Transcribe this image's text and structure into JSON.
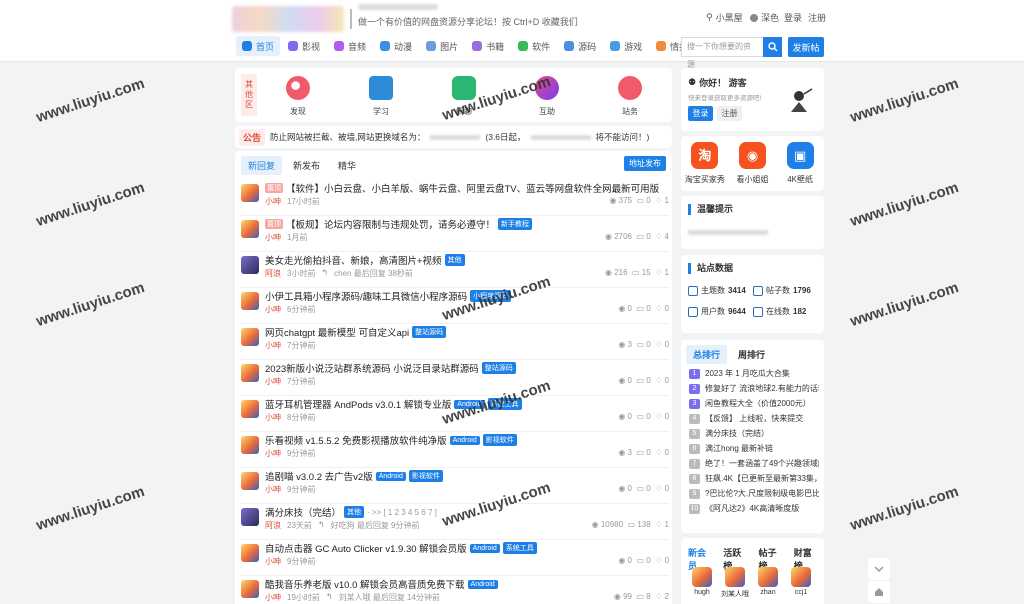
{
  "header": {
    "tagline": "做一个有价值的网盘资源分享论坛！按 Ctrl+D 收藏我们",
    "links": {
      "user": "小黑屋",
      "theme": "深色",
      "login": "登录",
      "register": "注册"
    }
  },
  "menu": [
    {
      "label": "首页",
      "color": "#1e80e6"
    },
    {
      "label": "影视",
      "color": "#7c6cf0"
    },
    {
      "label": "音频",
      "color": "#b45cf0"
    },
    {
      "label": "动漫",
      "color": "#3a8ee6"
    },
    {
      "label": "图片",
      "color": "#6a9ee0"
    },
    {
      "label": "书籍",
      "color": "#9c6ce0"
    },
    {
      "label": "软件",
      "color": "#3cba5a"
    },
    {
      "label": "源码",
      "color": "#4a8fe0"
    },
    {
      "label": "游戏",
      "color": "#4a9be6"
    },
    {
      "label": "情报",
      "color": "#f08a3c"
    }
  ],
  "search": {
    "placeholder": "搜一下你想要的资源",
    "post_label": "发新帖"
  },
  "categories": {
    "side_label": "其他区",
    "items": [
      "发现",
      "学习",
      "闲聊",
      "互助",
      "站务"
    ]
  },
  "notice": {
    "tag": "公告",
    "text": "防止网站被拦截、被墙,网站更换域名为：",
    "text2": "(3.6日起，",
    "text3": "将不能访问！)"
  },
  "thread_tabs": {
    "tabs": [
      "新回复",
      "新发布",
      "精华"
    ],
    "publish_label": "地址发布"
  },
  "threads": [
    {
      "hot": "置顶",
      "title": "【软件】小白云盘、小白羊版、蜗牛云盘、阿里云盘TV、蓝云等网盘软件全网最新可用版",
      "badges": [],
      "author": "小呻",
      "time": "17小时前",
      "last": "",
      "views": "375",
      "replies": "0",
      "likes": "1",
      "purple": false
    },
    {
      "hot": "置顶",
      "title": "【板规】论坛内容限制与违规处罚，请务必遵守！",
      "badges": [
        "新手教程"
      ],
      "author": "小呻",
      "time": "1月前",
      "last": "",
      "views": "2706",
      "replies": "0",
      "likes": "4",
      "purple": false
    },
    {
      "hot": "",
      "title": "美女走光偷拍抖音、新娘，高清图片+视频",
      "badges": [
        "其他"
      ],
      "author": "阿浪",
      "time": "3小时前",
      "last": "chen  最后回复 38秒前",
      "views": "216",
      "replies": "15",
      "likes": "1",
      "purple": true
    },
    {
      "hot": "",
      "title": "小伊工具箱小程序源码/趣味工具微信小程序源码",
      "badges": [
        "小程序源码"
      ],
      "author": "小呻",
      "time": "6分钟前",
      "last": "",
      "views": "0",
      "replies": "0",
      "likes": "0",
      "purple": false
    },
    {
      "hot": "",
      "title": "网页chatgpt 最新模型 可自定义api",
      "badges": [
        "整站源码"
      ],
      "author": "小呻",
      "time": "7分钟前",
      "last": "",
      "views": "3",
      "replies": "0",
      "likes": "0",
      "purple": false
    },
    {
      "hot": "",
      "title": "2023新版小说泛站群系统源码 小说泛目录站群源码",
      "badges": [
        "整站源码"
      ],
      "author": "小呻",
      "time": "7分钟前",
      "last": "",
      "views": "0",
      "replies": "0",
      "likes": "0",
      "purple": false
    },
    {
      "hot": "",
      "title": "蓝牙耳机管理器 AndPods v3.0.1 解锁专业版",
      "badges": [
        "Android",
        "系统工具"
      ],
      "author": "小呻",
      "time": "8分钟前",
      "last": "",
      "views": "0",
      "replies": "0",
      "likes": "0",
      "purple": false
    },
    {
      "hot": "",
      "title": "乐看视频 v1.5.5.2 免费影视播放软件纯净版",
      "badges": [
        "Android",
        "影视软件"
      ],
      "author": "小呻",
      "time": "9分钟前",
      "last": "",
      "views": "3",
      "replies": "0",
      "likes": "0",
      "purple": false
    },
    {
      "hot": "",
      "title": "追剧喵 v3.0.2 去广告v2版",
      "badges": [
        "Android",
        "影视软件"
      ],
      "author": "小呻",
      "time": "9分钟前",
      "last": "",
      "views": "0",
      "replies": "0",
      "likes": "0",
      "purple": false
    },
    {
      "hot": "",
      "title": "满分床技（完结）",
      "badges": [
        "其他"
      ],
      "extra": "· >> [ 1 2 3 4 5 6 7 ]",
      "author": "阿浪",
      "time": "23天前",
      "last": "好吃狗  最后回复 9分钟前",
      "views": "10980",
      "replies": "138",
      "likes": "1",
      "purple": true
    },
    {
      "hot": "",
      "title": "自动点击器 GC Auto Clicker v1.9.30 解锁会员版",
      "badges": [
        "Android",
        "系统工具"
      ],
      "author": "小呻",
      "time": "9分钟前",
      "last": "",
      "views": "0",
      "replies": "0",
      "likes": "0",
      "purple": false
    },
    {
      "hot": "",
      "title": "酷我音乐养老版 v10.0 解锁会员高音质免费下载",
      "badges": [
        "Android"
      ],
      "author": "小呻",
      "time": "19小时前",
      "last": "刘某人哦  最后回复 14分钟前",
      "views": "99",
      "replies": "8",
      "likes": "2",
      "purple": false
    }
  ],
  "welcome": {
    "title": "你好！ 游客",
    "subtitle": "快来登录获取更多资源吧!",
    "login": "登录",
    "register": "注册"
  },
  "apps": [
    {
      "label": "淘宝买家秀",
      "icon": "淘",
      "color": "#f5521f"
    },
    {
      "label": "看小姐姐",
      "icon": "◉",
      "color": "#f5521f"
    },
    {
      "label": "4K壁纸",
      "icon": "▣",
      "color": "#1e80e6"
    }
  ],
  "tips": {
    "title": "温馨提示"
  },
  "site_stats": {
    "title": "站点数据",
    "items": [
      {
        "label": "主题数",
        "value": "3414"
      },
      {
        "label": "帖子数",
        "value": "1796"
      },
      {
        "label": "用户数",
        "value": "9644"
      },
      {
        "label": "在线数",
        "value": "182"
      }
    ]
  },
  "rank": {
    "tabs": [
      "总排行",
      "周排行"
    ],
    "items": [
      {
        "n": "1",
        "text": "2023 年 1 月吃瓜大合集",
        "color": "#7c6cf0"
      },
      {
        "n": "2",
        "text": "修复好了 流浪地球2.有能力的话就去",
        "color": "#7c6cf0"
      },
      {
        "n": "3",
        "text": "闲鱼教程大全（价值2000元）",
        "color": "#7c6cf0"
      },
      {
        "n": "4",
        "text": "【反馈】           上线啦，快来提交",
        "color": "#bbb"
      },
      {
        "n": "5",
        "text": "满分床技（完结）",
        "color": "#bbb"
      },
      {
        "n": "6",
        "text": "满江hong 最新补链",
        "color": "#bbb"
      },
      {
        "n": "7",
        "text": "绝了！一套涵盖了49个兴趣领域的教",
        "color": "#bbb"
      },
      {
        "n": "8",
        "text": "狂飙.4K【已更新至最新第33集，持续",
        "color": "#bbb"
      },
      {
        "n": "9",
        "text": "?巴比伦?大.尺度限制级电影巴比伦，布",
        "color": "#bbb"
      },
      {
        "n": "10",
        "text": "《阿凡达2》4K高清晰度版",
        "color": "#bbb"
      }
    ]
  },
  "members": {
    "tabs": [
      "新会员",
      "活跃榜",
      "帖子榜",
      "财富榜"
    ],
    "items": [
      "hugh",
      "刘某人哦",
      "zhan",
      "ccj1"
    ]
  },
  "watermarks": [
    "www.liuyiu.com",
    "www.liuyiu.com",
    "www.liuyiu.com",
    "www.liuyiu.com",
    "www.liuyiu.com",
    "www.liuyiu.com",
    "www.liuyiu.com",
    "www.liuyiu.com",
    "www.liuyiu.com",
    "www.liuyiu.com",
    "www.liuyiu.com",
    "www.liuyiu.com"
  ]
}
